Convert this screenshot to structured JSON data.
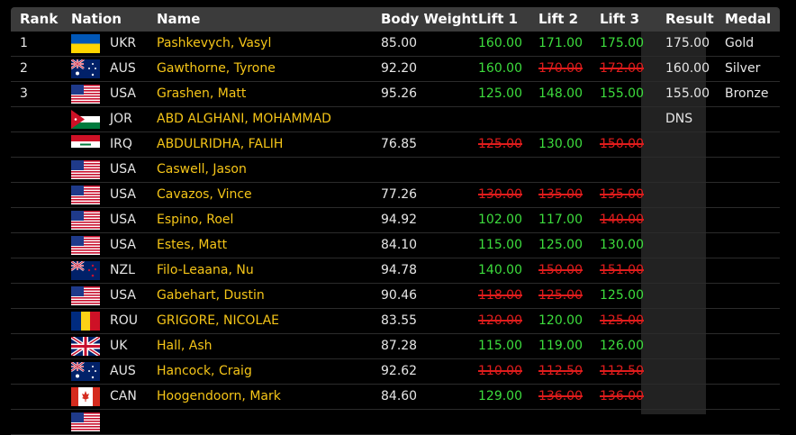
{
  "headers": {
    "rank": "Rank",
    "nation": "Nation",
    "name": "Name",
    "body_weight": "Body Weight",
    "lift1": "Lift 1",
    "lift2": "Lift 2",
    "lift3": "Lift 3",
    "result": "Result",
    "medal": "Medal"
  },
  "rows": [
    {
      "rank": "1",
      "flag": "ukraine-flag",
      "nation": "UKR",
      "name": "Pashkevych, Vasyl",
      "bw": "85.00",
      "l1": "160.00",
      "l1s": "good",
      "l2": "171.00",
      "l2s": "good",
      "l3": "175.00",
      "l3s": "good",
      "result": "175.00",
      "medal": "Gold"
    },
    {
      "rank": "2",
      "flag": "australia-flag",
      "nation": "AUS",
      "name": "Gawthorne, Tyrone",
      "bw": "92.20",
      "l1": "160.00",
      "l1s": "good",
      "l2": "170.00",
      "l2s": "fail",
      "l3": "172.00",
      "l3s": "fail",
      "result": "160.00",
      "medal": "Silver"
    },
    {
      "rank": "3",
      "flag": "usa-flag",
      "nation": "USA",
      "name": "Grashen, Matt",
      "bw": "95.26",
      "l1": "125.00",
      "l1s": "good",
      "l2": "148.00",
      "l2s": "good",
      "l3": "155.00",
      "l3s": "good",
      "result": "155.00",
      "medal": "Bronze"
    },
    {
      "rank": "",
      "flag": "jordan-flag",
      "nation": "JOR",
      "name": "ABD ALGHANI, MOHAMMAD",
      "bw": "",
      "l1": "",
      "l1s": "good",
      "l2": "",
      "l2s": "good",
      "l3": "",
      "l3s": "good",
      "result": "DNS",
      "medal": ""
    },
    {
      "rank": "",
      "flag": "iraq-flag",
      "nation": "IRQ",
      "name": "ABDULRIDHA, FALIH",
      "bw": "76.85",
      "l1": "125.00",
      "l1s": "fail",
      "l2": "130.00",
      "l2s": "good",
      "l3": "150.00",
      "l3s": "fail",
      "result": "",
      "medal": ""
    },
    {
      "rank": "",
      "flag": "usa-flag",
      "nation": "USA",
      "name": "Caswell, Jason",
      "bw": "",
      "l1": "",
      "l1s": "good",
      "l2": "",
      "l2s": "good",
      "l3": "",
      "l3s": "good",
      "result": "",
      "medal": ""
    },
    {
      "rank": "",
      "flag": "usa-flag",
      "nation": "USA",
      "name": "Cavazos, Vince",
      "bw": "77.26",
      "l1": "130.00",
      "l1s": "fail",
      "l2": "135.00",
      "l2s": "fail",
      "l3": "135.00",
      "l3s": "fail",
      "result": "",
      "medal": ""
    },
    {
      "rank": "",
      "flag": "usa-flag",
      "nation": "USA",
      "name": "Espino, Roel",
      "bw": "94.92",
      "l1": "102.00",
      "l1s": "good",
      "l2": "117.00",
      "l2s": "good",
      "l3": "140.00",
      "l3s": "fail",
      "result": "",
      "medal": ""
    },
    {
      "rank": "",
      "flag": "usa-flag",
      "nation": "USA",
      "name": "Estes, Matt",
      "bw": "84.10",
      "l1": "115.00",
      "l1s": "good",
      "l2": "125.00",
      "l2s": "good",
      "l3": "130.00",
      "l3s": "good",
      "result": "",
      "medal": ""
    },
    {
      "rank": "",
      "flag": "new-zealand-flag",
      "nation": "NZL",
      "name": "Filo-Leaana, Nu",
      "bw": "94.78",
      "l1": "140.00",
      "l1s": "good",
      "l2": "150.00",
      "l2s": "fail",
      "l3": "151.00",
      "l3s": "fail",
      "result": "",
      "medal": ""
    },
    {
      "rank": "",
      "flag": "usa-flag",
      "nation": "USA",
      "name": "Gabehart, Dustin",
      "bw": "90.46",
      "l1": "118.00",
      "l1s": "fail",
      "l2": "125.00",
      "l2s": "fail",
      "l3": "125.00",
      "l3s": "good",
      "result": "",
      "medal": ""
    },
    {
      "rank": "",
      "flag": "romania-flag",
      "nation": "ROU",
      "name": "GRIGORE, NICOLAE",
      "bw": "83.55",
      "l1": "120.00",
      "l1s": "fail",
      "l2": "120.00",
      "l2s": "good",
      "l3": "125.00",
      "l3s": "fail",
      "result": "",
      "medal": ""
    },
    {
      "rank": "",
      "flag": "uk-flag",
      "nation": "UK",
      "name": "Hall, Ash",
      "bw": "87.28",
      "l1": "115.00",
      "l1s": "good",
      "l2": "119.00",
      "l2s": "good",
      "l3": "126.00",
      "l3s": "good",
      "result": "",
      "medal": ""
    },
    {
      "rank": "",
      "flag": "australia-flag",
      "nation": "AUS",
      "name": "Hancock, Craig",
      "bw": "92.62",
      "l1": "110.00",
      "l1s": "fail",
      "l2": "112.50",
      "l2s": "fail",
      "l3": "112.50",
      "l3s": "fail",
      "result": "",
      "medal": ""
    },
    {
      "rank": "",
      "flag": "canada-flag",
      "nation": "CAN",
      "name": "Hoogendoorn, Mark",
      "bw": "84.60",
      "l1": "129.00",
      "l1s": "good",
      "l2": "136.00",
      "l2s": "fail",
      "l3": "136.00",
      "l3s": "fail",
      "result": "",
      "medal": ""
    },
    {
      "rank": "",
      "flag": "usa-flag",
      "nation": "",
      "name": "",
      "bw": "",
      "l1": "",
      "l1s": "good",
      "l2": "",
      "l2s": "good",
      "l3": "",
      "l3s": "good",
      "result": "",
      "medal": ""
    }
  ],
  "colors": {
    "name": "#f5c518",
    "good_lift": "#3ddc3d",
    "failed_lift": "#e01c1c",
    "header_bg": "#3b3b3b"
  }
}
